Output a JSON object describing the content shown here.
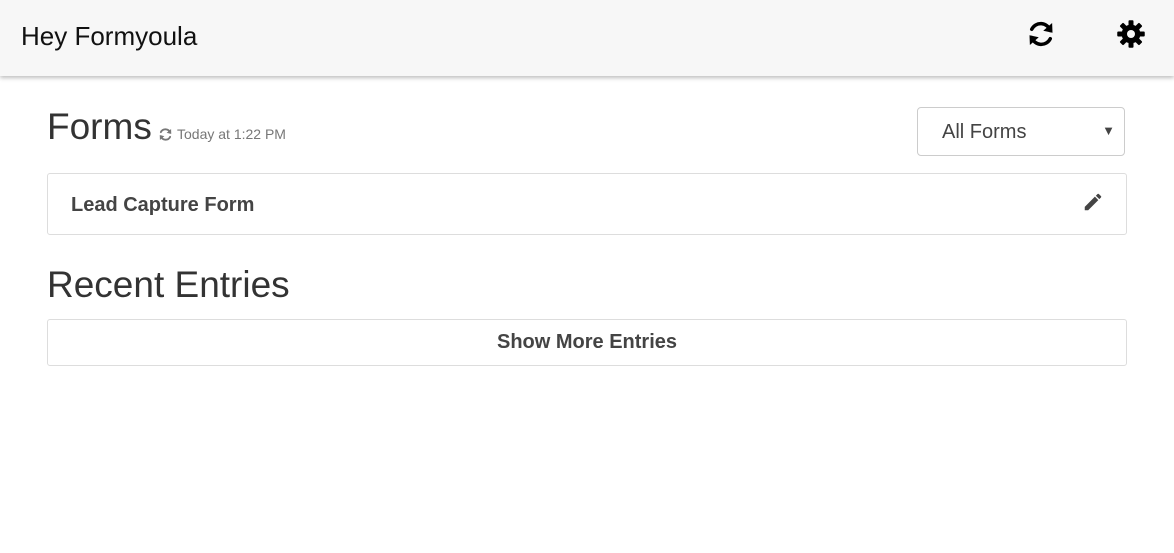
{
  "header": {
    "title": "Hey Formyoula",
    "refresh_icon": "refresh-icon",
    "settings_icon": "gear-icon"
  },
  "forms": {
    "title": "Forms",
    "sync_icon": "refresh-icon",
    "sync_status": "Today at 1:22 PM",
    "filter": {
      "selected": "All Forms"
    },
    "items": [
      {
        "name": "Lead Capture Form",
        "action_icon": "pencil-icon"
      }
    ]
  },
  "entries": {
    "title": "Recent Entries",
    "show_more_label": "Show More Entries"
  },
  "colors": {
    "topbar_bg": "#f7f7f7",
    "text": "#333333",
    "muted": "#777777",
    "border": "#dddddd"
  }
}
